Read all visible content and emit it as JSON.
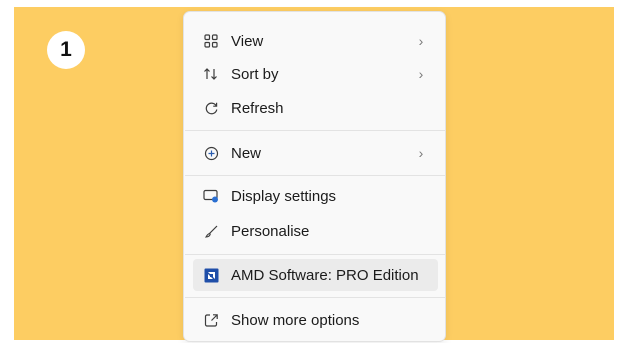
{
  "step_badge": "1",
  "menu": {
    "items": [
      {
        "label": "View",
        "icon": "grid-icon",
        "has_submenu": true
      },
      {
        "label": "Sort by",
        "icon": "sort-arrows-icon",
        "has_submenu": true
      },
      {
        "label": "Refresh",
        "icon": "refresh-icon",
        "has_submenu": false
      },
      {
        "label": "New",
        "icon": "plus-circle-icon",
        "has_submenu": true
      },
      {
        "label": "Display settings",
        "icon": "display-icon",
        "has_submenu": false
      },
      {
        "label": "Personalise",
        "icon": "brush-icon",
        "has_submenu": false
      },
      {
        "label": "AMD Software: PRO Edition",
        "icon": "amd-logo-icon",
        "has_submenu": false,
        "highlighted": true
      },
      {
        "label": "Show more options",
        "icon": "open-external-icon",
        "has_submenu": false
      }
    ],
    "chevron": "›"
  },
  "colors": {
    "backdrop": "#fdcd62",
    "menu_background": "#f9f9f9",
    "highlight": "#ebebeb",
    "amd_blue": "#1f4ea8"
  }
}
